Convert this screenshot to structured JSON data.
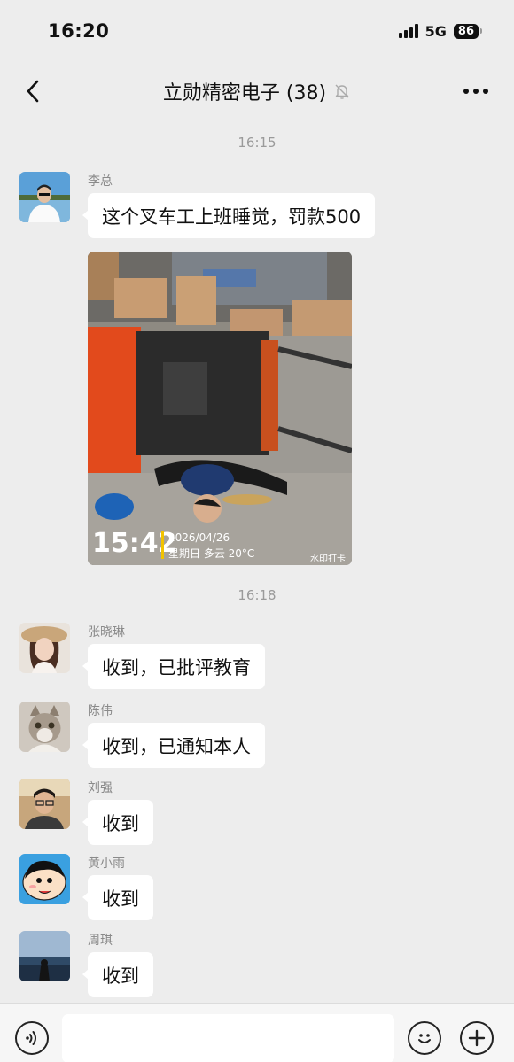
{
  "status_bar": {
    "time": "16:20",
    "network": "5G",
    "battery": "86"
  },
  "header": {
    "title": "立勋精密电子 (38)",
    "muted_icon": "bell-slash-icon",
    "back_icon": "chevron-left-icon",
    "more_icon": "ellipsis-icon"
  },
  "timestamps": [
    "16:15",
    "16:18"
  ],
  "messages": [
    {
      "sender": "李总",
      "text": "这个叉车工上班睡觉，罚款500"
    },
    {
      "sender": "李总",
      "image": {
        "watermark_time": "15:42",
        "watermark_date": "2026/04/26",
        "watermark_weather": "星期日 多云 20°C",
        "watermark_brand": "水印打卡"
      }
    },
    {
      "sender": "张晓琳",
      "text": "收到，已批评教育"
    },
    {
      "sender": "陈伟",
      "text": "收到，已通知本人"
    },
    {
      "sender": "刘强",
      "text": "收到"
    },
    {
      "sender": "黄小雨",
      "text": "收到"
    },
    {
      "sender": "周琪",
      "text": "收到"
    }
  ],
  "input_bar": {
    "voice_icon": "voice-icon",
    "emoji_icon": "emoji-icon",
    "plus_icon": "plus-icon",
    "placeholder": ""
  }
}
